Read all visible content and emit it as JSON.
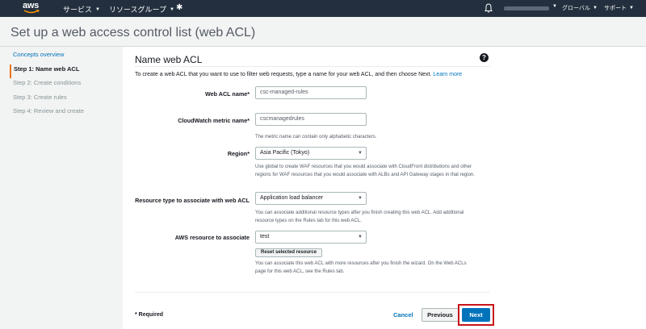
{
  "topnav": {
    "logo_text": "aws",
    "services_label": "サービス",
    "resource_groups_label": "リソースグループ",
    "region_label": "グローバル",
    "support_label": "サポート"
  },
  "page": {
    "title": "Set up a web access control list (web ACL)"
  },
  "steps": [
    {
      "label": "Concepts overview",
      "state": "link"
    },
    {
      "label": "Step 1: Name web ACL",
      "state": "active"
    },
    {
      "label": "Step 2: Create conditions",
      "state": "disabled"
    },
    {
      "label": "Step 3: Create rules",
      "state": "disabled"
    },
    {
      "label": "Step 4: Review and create",
      "state": "disabled"
    }
  ],
  "panel": {
    "title": "Name web ACL",
    "intro": "To create a web ACL that you want to use to filter web requests, type a name for your web ACL, and then choose Next.",
    "learn_more": "Learn more"
  },
  "form": {
    "web_acl_name_label": "Web ACL name*",
    "web_acl_name_value": "csc-managed-rules",
    "metric_name_label": "CloudWatch metric name*",
    "metric_name_value": "cscmanagedrules",
    "metric_help": "The metric name can contain only alphabetic characters.",
    "region_label": "Region*",
    "region_value": "Asia Pacific (Tokyo)",
    "region_help": "Use global to create WAF resources that you would associate with CloudFront distributions and other regions for WAF resources that you would associate with ALBs and API Gateway stages in that region.",
    "resource_type_label": "Resource type to associate with web ACL",
    "resource_type_value": "Application load balancer",
    "resource_type_help": "You can associate additional resource types after you finish creating this web ACL. Add additional resource types on the Rules tab for this web ACL.",
    "aws_resource_label": "AWS resource to associate",
    "aws_resource_value": "test",
    "reset_button": "Reset selected resource",
    "aws_resource_help": "You can associate this web ACL with more resources after you finish the wizard. On the Web ACLs page for this web ACL, see the Rules tab."
  },
  "footer": {
    "required_note": "* Required",
    "cancel": "Cancel",
    "previous": "Previous",
    "next": "Next"
  },
  "colors": {
    "nav_bg": "#232f3e",
    "link": "#0073bb",
    "active_marker": "#ec7211",
    "primary_button": "#0073bb",
    "highlight_outline": "#c7141a"
  }
}
